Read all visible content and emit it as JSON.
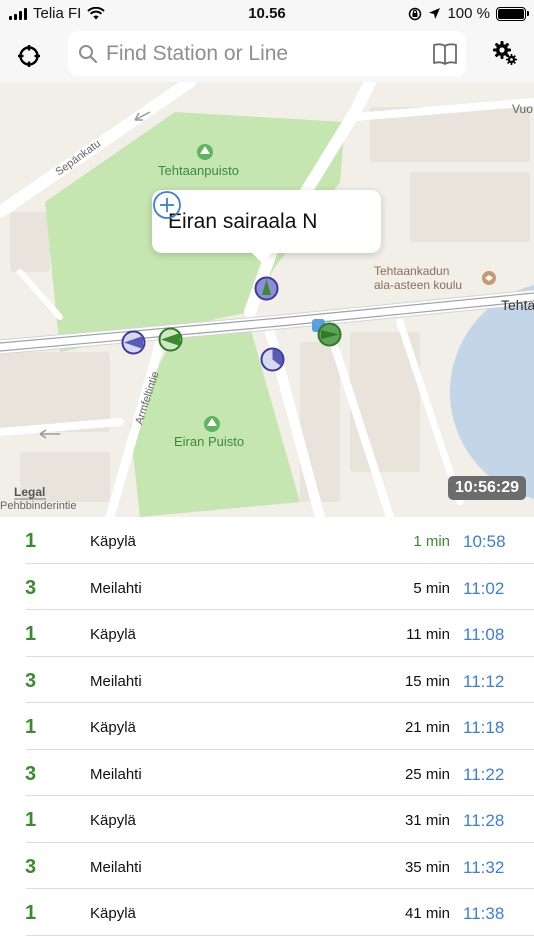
{
  "status_bar": {
    "carrier": "Telia FI",
    "time": "10.56",
    "battery_percent": "100 %",
    "battery_level": 1.0
  },
  "toolbar": {
    "locate_icon": "crosshair-icon",
    "search_placeholder": "Find Station or Line",
    "book_icon": "book-icon",
    "settings_icon": "gear-icon"
  },
  "map": {
    "labels": {
      "park_north": "Tehtaanpuisto",
      "park_south": "Eiran Puisto",
      "school": "Tehtaankadun\nala-asteen koulu",
      "street_sepankatu": "Sepänkatu",
      "street_armfeltintie": "Armfeltintie",
      "street_tehta": "Tehta",
      "street_vuo": "Vuo",
      "street_bottom": "Pehbbinderintie",
      "legal": "Legal"
    },
    "callout": {
      "title": "Eiran sairaala N",
      "add_icon": "plus-circle-icon"
    },
    "clock": "10:56:29",
    "colors": {
      "park": "#c6e6b1",
      "road": "#ffffff",
      "land": "#f2efe9",
      "water": "#b7cfe6",
      "tram_green": "#3a8a2e",
      "tram_blue": "#5a5ab8"
    }
  },
  "departures": [
    {
      "line": "1",
      "destination": "Käpylä",
      "eta": "1 min",
      "time": "10:58",
      "soon": true
    },
    {
      "line": "3",
      "destination": "Meilahti",
      "eta": "5 min",
      "time": "11:02",
      "soon": false
    },
    {
      "line": "1",
      "destination": "Käpylä",
      "eta": "11 min",
      "time": "11:08",
      "soon": false
    },
    {
      "line": "3",
      "destination": "Meilahti",
      "eta": "15 min",
      "time": "11:12",
      "soon": false
    },
    {
      "line": "1",
      "destination": "Käpylä",
      "eta": "21 min",
      "time": "11:18",
      "soon": false
    },
    {
      "line": "3",
      "destination": "Meilahti",
      "eta": "25 min",
      "time": "11:22",
      "soon": false
    },
    {
      "line": "1",
      "destination": "Käpylä",
      "eta": "31 min",
      "time": "11:28",
      "soon": false
    },
    {
      "line": "3",
      "destination": "Meilahti",
      "eta": "35 min",
      "time": "11:32",
      "soon": false
    },
    {
      "line": "1",
      "destination": "Käpylä",
      "eta": "41 min",
      "time": "11:38",
      "soon": false
    }
  ]
}
